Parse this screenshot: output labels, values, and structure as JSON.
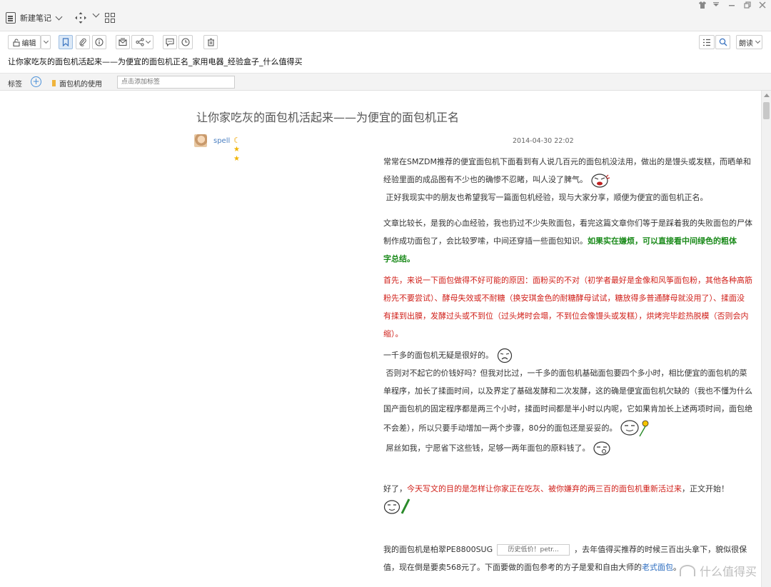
{
  "topbar": {
    "new_note_label": "新建笔记",
    "window_controls": [
      "shirt-icon",
      "dropdown-icon",
      "minimize-icon",
      "restore-icon",
      "close-icon"
    ]
  },
  "toolbar": {
    "edit_label": "编辑",
    "read_aloud_label": "朗读"
  },
  "note": {
    "title": "让你家吃灰的面包机活起来——为便宜的面包机正名_家用电器_经验盒子_什么值得买"
  },
  "tags": {
    "label": "标签",
    "chip": "面包机的使用",
    "placeholder": "点击添加标签"
  },
  "article": {
    "title": "让你家吃灰的面包机活起来——为便宜的面包机正名",
    "author": "spell",
    "date": "2014-04-30 22:02",
    "p1a": "常常在SMZDM推荐的便宜面包机下面看到有人说几百元的面包机没法用，做出的是馒头或发糕，而晒单和",
    "p1b": "经验里面的成品图有不少也的确惨不忍睹，叫人没了脾气。",
    "p1c": "正好我现实中的朋友也希望我写一篇面包机经验，现与大家分享，顺便为便宜的面包机正名。",
    "p2a": "文章比较长，是我的心血经验，我也扔过不少失败面包，看完这篇文章你们等于是踩着我的失败面包的尸体",
    "p2b": "制作成功面包了，会比较罗嗦，中间还穿插一些面包知识。",
    "p2c": "如果实在嫌烦，可以直接看中间绿色的粗体",
    "p2d": "字总结。",
    "p3a": "首先，来说一下面包做得不好可能的原因：面粉买的不对（初学者最好是金像和风筝面包粉，其他各种高筋",
    "p3b": "粉先不要尝试）、酵母失效或不耐糖（换安琪金色的耐糖酵母试试，糖放得多普通酵母就没用了）、揉面没",
    "p3c": "有揉到出膜，发酵过头或不到位（过头烤时会塌，不到位会像馒头或发糕），烘烤完毕趁热脱模（否则会内",
    "p3d": "缩）。",
    "p4a": "一千多的面包机无疑是很好的。",
    "p4b": "否则对不起它的价钱好吗？但我对比过，一千多的面包机基础面包要四个多小时，相比便宜的面包机的菜",
    "p4c": "单程序，加长了揉面时间，以及界定了基础发酵和二次发酵，这的确是便宜面包机欠缺的（我也不懂为什么",
    "p4d": "国产面包机的固定程序都是两三个小时，揉面时间都是半小时以内呢，它如果肯加长上述两项时间，面包绝",
    "p4e": "不会差），所以只要手动增加一两个步骤，80分的面包还是妥妥的。",
    "p4f": "屌丝如我，宁愿省下这些钱，足够一两年面包的原料钱了。",
    "p5a": "好了，",
    "p5b": "今天写文的目的是怎样让你家正在吃灰、被你嫌弃的两三百的面包机重新活过来",
    "p5c": "，正文开始！",
    "p6a": "我的面包机是柏翠PE8800SUG",
    "p6_box": "历史低价！petr...",
    "p6b": "，去年值得买推荐的时候三百出头拿下，貌似很保",
    "p6c": "值，现在倒是要卖568元了。下面要做的面包参考的方子是爱和自由大师的",
    "p6_link": "老式面包",
    "p6d": "。"
  },
  "watermark": "什么值得买",
  "colors": {
    "green_bold": "#1a8a1a",
    "red_text": "#d0201a",
    "link": "#2a6bbf",
    "author": "#4a7fc1"
  }
}
